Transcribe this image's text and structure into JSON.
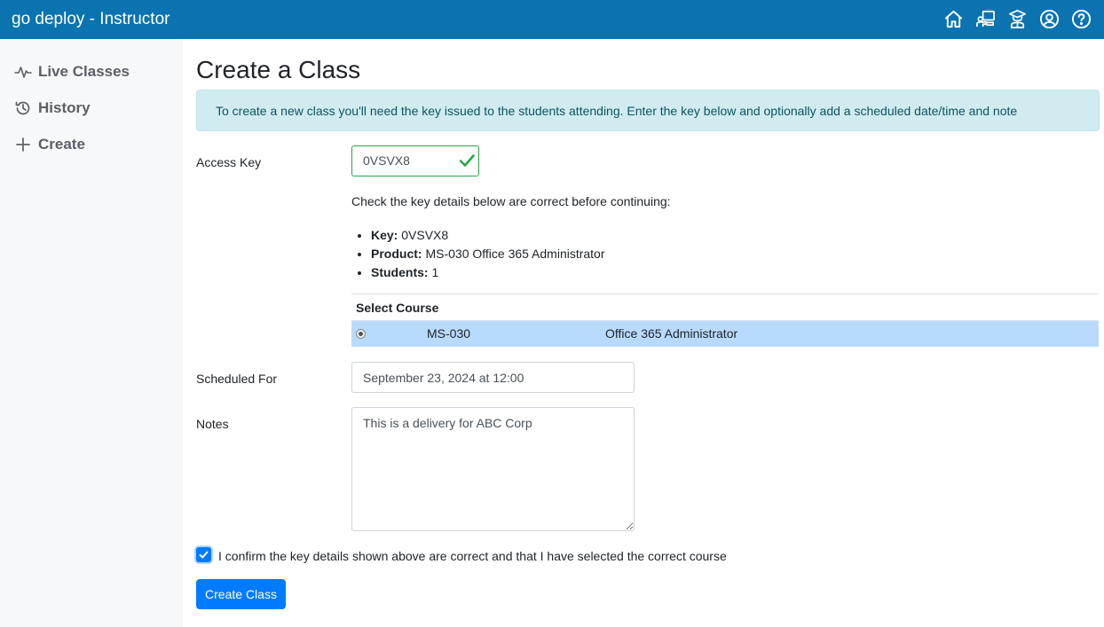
{
  "app": {
    "title": "go deploy - Instructor",
    "header_icons": [
      "home-icon",
      "classroom-icon",
      "instructor-icon",
      "account-icon",
      "help-icon"
    ]
  },
  "sidebar": {
    "items": [
      {
        "label": "Live Classes",
        "icon": "pulse-icon"
      },
      {
        "label": "History",
        "icon": "history-icon"
      },
      {
        "label": "Create",
        "icon": "plus-icon"
      }
    ]
  },
  "main": {
    "title": "Create a Class",
    "info": "To create a new class you'll need the key issued to the students attending. Enter the key below and optionally add a scheduled date/time and note",
    "access_key": {
      "label": "Access Key",
      "value": "0VSVX8",
      "valid": true
    },
    "check_text": "Check the key details below are correct before continuing:",
    "details": {
      "key_label": "Key:",
      "key_value": "0VSVX8",
      "product_label": "Product:",
      "product_value": "MS-030 Office 365 Administrator",
      "students_label": "Students:",
      "students_value": "1"
    },
    "course": {
      "header": "Select Course",
      "rows": [
        {
          "code": "MS-030",
          "name": "Office 365 Administrator",
          "selected": true
        }
      ]
    },
    "scheduled": {
      "label": "Scheduled For",
      "value": "September 23, 2024 at 12:00"
    },
    "notes": {
      "label": "Notes",
      "value": "This is a delivery for ABC Corp"
    },
    "confirm": {
      "label": "I confirm the key details shown above are correct and that I have selected the correct course",
      "checked": true
    },
    "submit_label": "Create Class"
  },
  "colors": {
    "header_bg": "#0a73b0",
    "sidebar_bg": "#f7f8fa",
    "alert_bg": "#d1ecf1",
    "selected_row": "#b8daff",
    "primary": "#007bff",
    "valid": "#28a745"
  }
}
